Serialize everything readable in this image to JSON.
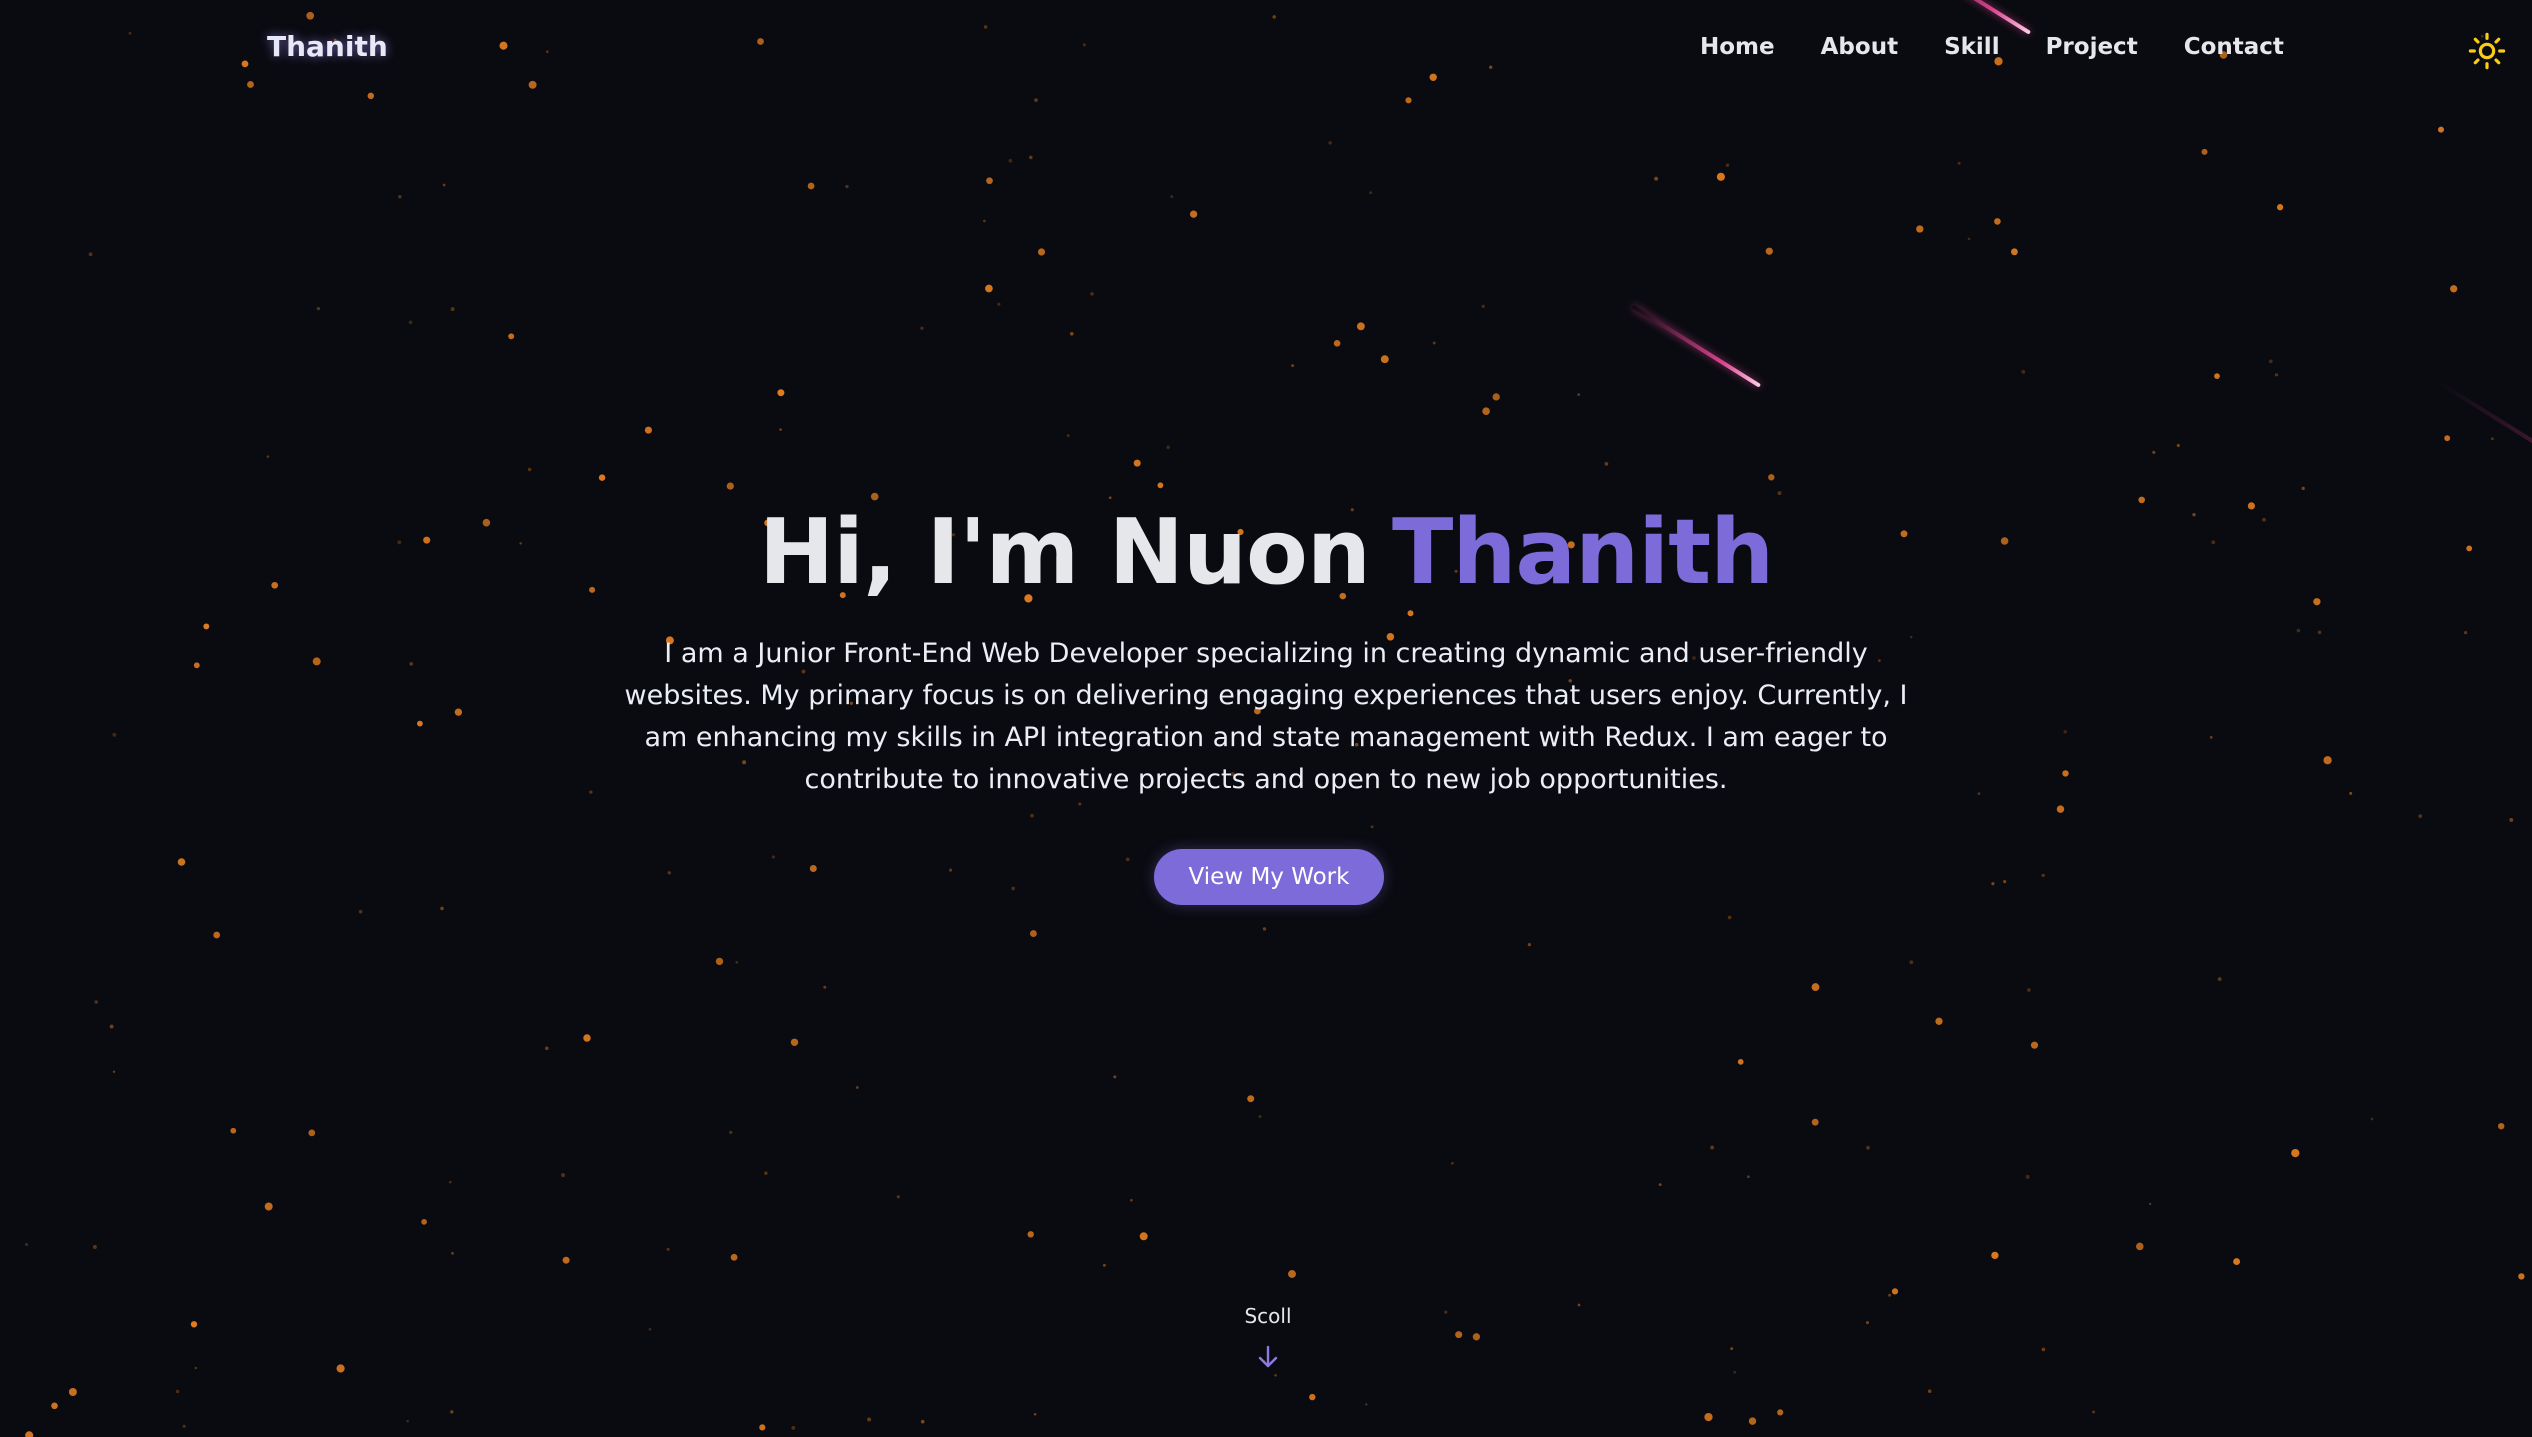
{
  "header": {
    "brand": "Thanith",
    "nav": [
      {
        "label": "Home"
      },
      {
        "label": "About"
      },
      {
        "label": "Skill"
      },
      {
        "label": "Project"
      },
      {
        "label": "Contact"
      }
    ],
    "theme_toggle_icon": "sun-icon"
  },
  "hero": {
    "greeting": "Hi, I'm Nuon",
    "name_highlight": "Thanith",
    "description": "I am a Junior Front-End Web Developer specializing in creating dynamic and user-friendly websites. My primary focus is on delivering engaging experiences that users enjoy. Currently, I am enhancing my skills in API integration and state management with Redux. I am eager to contribute to innovative projects and open to new job opportunities.",
    "cta_label": "View My Work"
  },
  "scroll": {
    "label": "Scoll",
    "icon": "arrow-down-icon"
  },
  "colors": {
    "background": "#0a0b11",
    "accent": "#7c6bd8",
    "star": "#e07b1f",
    "meteor": "#ec4899",
    "sun_icon": "#facc15"
  }
}
